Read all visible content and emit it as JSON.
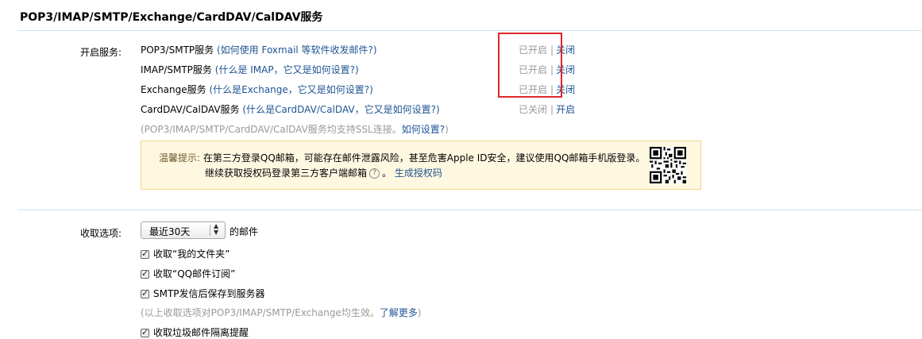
{
  "section_title": "POP3/IMAP/SMTP/Exchange/CardDAV/CalDAV服务",
  "open_services_label": "开启服务:",
  "services": [
    {
      "name": "POP3/SMTP服务",
      "help_prefix": "(",
      "help": "如何使用 Foxmail 等软件收发邮件?",
      "help_suffix": ")",
      "status": "已开启",
      "action": "关闭"
    },
    {
      "name": "IMAP/SMTP服务",
      "help_prefix": "(",
      "help": "什么是 IMAP，它又是如何设置?",
      "help_suffix": ")",
      "status": "已开启",
      "action": "关闭"
    },
    {
      "name": "Exchange服务",
      "help_prefix": "(",
      "help": "什么是Exchange，它又是如何设置?",
      "help_suffix": ")",
      "status": "已开启",
      "action": "关闭"
    },
    {
      "name": "CardDAV/CalDAV服务",
      "help_prefix": "(",
      "help": "什么是CardDAV/CalDAV，它又是如何设置?",
      "help_suffix": ")",
      "status": "已关闭",
      "action": "开启"
    }
  ],
  "ssl_note": {
    "text": "(POP3/IMAP/SMTP/CardDAV/CalDAV服务均支持SSL连接。",
    "link": "如何设置?",
    "suffix": ")"
  },
  "tip": {
    "label": "温馨提示:",
    "line1": "在第三方登录QQ邮箱，可能存在邮件泄露风险，甚至危害Apple ID安全，建议使用QQ邮箱手机版登录。",
    "line2": "继续获取授权码登录第三方客户端邮箱",
    "help_glyph": "?",
    "line2_suffix": "。",
    "link": "生成授权码"
  },
  "receive": {
    "label": "收取选项:",
    "select_value": "最近30天",
    "after_select": "的邮件",
    "options": [
      {
        "label": "收取“我的文件夹”",
        "checked": true
      },
      {
        "label": "收取“QQ邮件订阅”",
        "checked": true
      },
      {
        "label": "SMTP发信后保存到服务器",
        "checked": true
      }
    ],
    "note": {
      "text": "(以上收取选项对POP3/IMAP/SMTP/Exchange均生效。",
      "link": "了解更多",
      "suffix": ")"
    },
    "last_option": {
      "label": "收取垃圾邮件隔离提醒",
      "checked": true
    }
  },
  "colors": {
    "link": "#1e5494",
    "highlight_box": "#e0262a",
    "tip_bg": "#fff8e1",
    "tip_border": "#f0d58a",
    "divider": "#cfe3f2"
  }
}
